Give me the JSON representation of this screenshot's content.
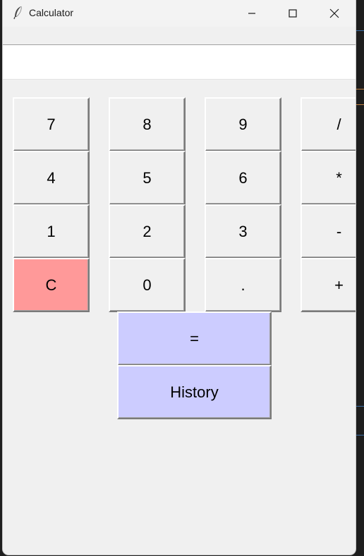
{
  "window": {
    "title": "Calculator"
  },
  "display": {
    "value": ""
  },
  "keypad": {
    "rows": [
      [
        "7",
        "8",
        "9",
        "/"
      ],
      [
        "4",
        "5",
        "6",
        "*"
      ],
      [
        "1",
        "2",
        "3",
        "-"
      ],
      [
        "C",
        "0",
        ".",
        "+"
      ]
    ],
    "equals": "=",
    "history": "History"
  },
  "colors": {
    "clear_button": "#ff9999",
    "action_buttons": "#ccccff",
    "window_background": "#f0f0f0"
  },
  "icons": [
    "feather-icon",
    "minimize-icon",
    "maximize-icon",
    "close-icon"
  ]
}
